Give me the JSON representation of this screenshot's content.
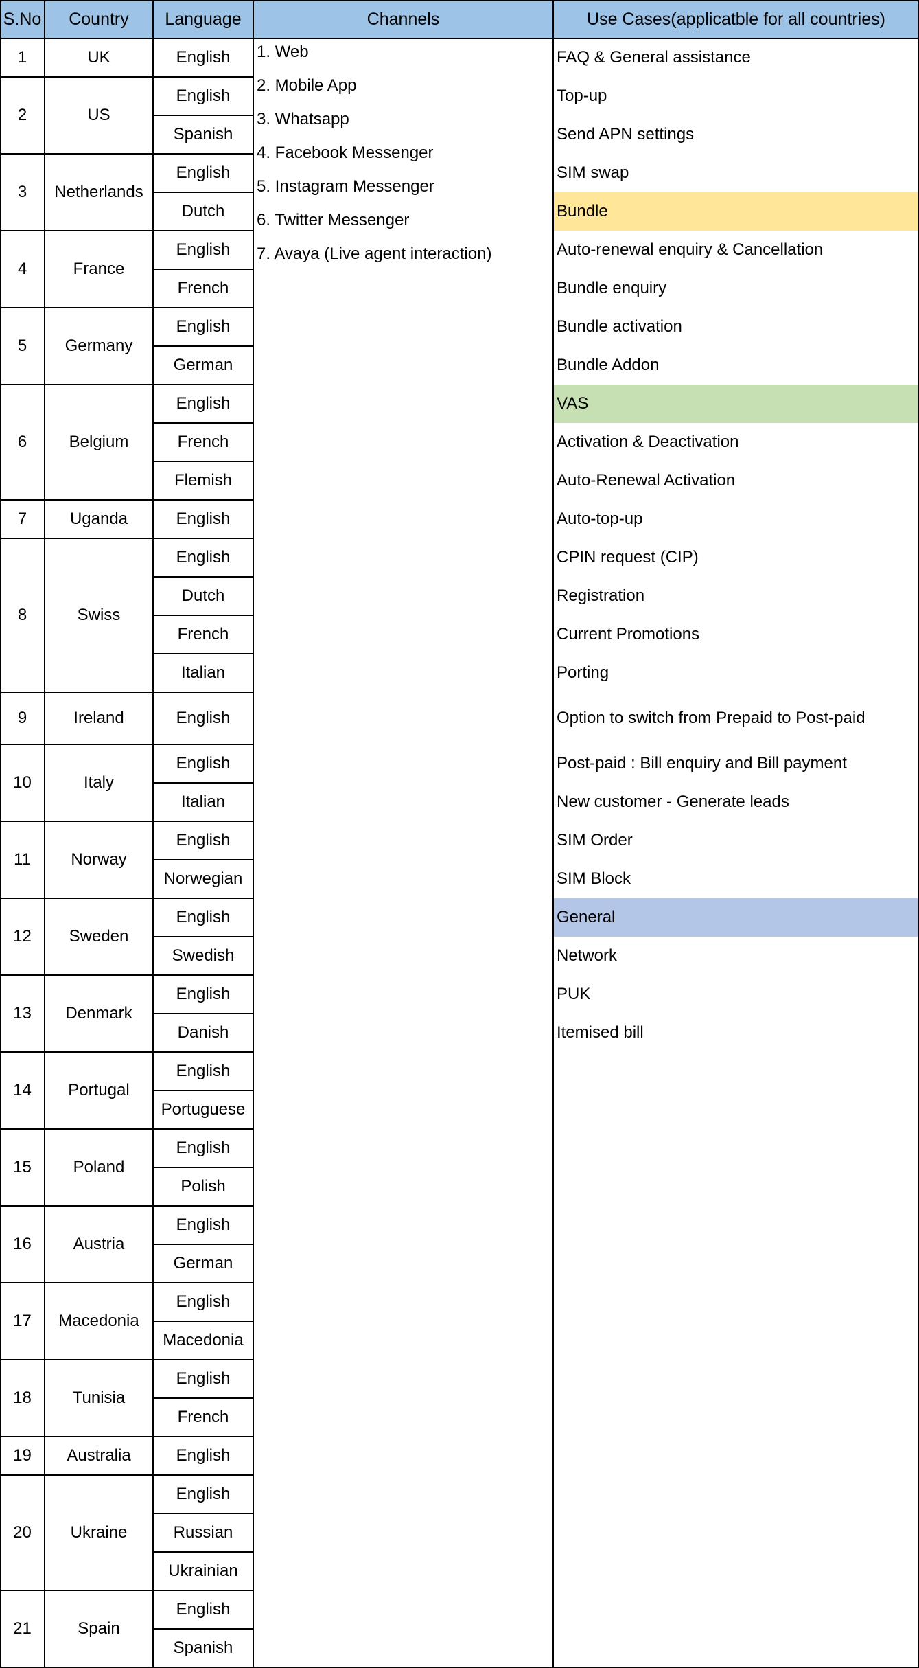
{
  "header": {
    "sno": "S.No",
    "country": "Country",
    "language": "Language",
    "channels": "Channels",
    "use_cases": "Use Cases(applicatble for all countries)"
  },
  "colors": {
    "header_bg": "#9DC3E6",
    "bundle_highlight": "#FFE699",
    "vas_highlight": "#C6E0B4",
    "general_highlight": "#B4C6E7",
    "grid_line": "#000000"
  },
  "countries": [
    {
      "sno": "1",
      "country": "UK",
      "languages": [
        "English"
      ]
    },
    {
      "sno": "2",
      "country": "US",
      "languages": [
        "English",
        "Spanish"
      ]
    },
    {
      "sno": "3",
      "country": "Netherlands",
      "languages": [
        "English",
        "Dutch"
      ]
    },
    {
      "sno": "4",
      "country": "France",
      "languages": [
        "English",
        "French"
      ]
    },
    {
      "sno": "5",
      "country": "Germany",
      "languages": [
        "English",
        "German"
      ]
    },
    {
      "sno": "6",
      "country": "Belgium",
      "languages": [
        "English",
        "French",
        "Flemish"
      ]
    },
    {
      "sno": "7",
      "country": "Uganda",
      "languages": [
        "English"
      ]
    },
    {
      "sno": "8",
      "country": "Swiss",
      "languages": [
        "English",
        "Dutch",
        "French",
        "Italian"
      ]
    },
    {
      "sno": "9",
      "country": "Ireland",
      "languages": [
        "English"
      ],
      "tall": true
    },
    {
      "sno": "10",
      "country": "Italy",
      "languages": [
        "English",
        "Italian"
      ]
    },
    {
      "sno": "11",
      "country": "Norway",
      "languages": [
        "English",
        "Norwegian"
      ]
    },
    {
      "sno": "12",
      "country": "Sweden",
      "languages": [
        "English",
        "Swedish"
      ]
    },
    {
      "sno": "13",
      "country": "Denmark",
      "languages": [
        "English",
        "Danish"
      ]
    },
    {
      "sno": "14",
      "country": "Portugal",
      "languages": [
        "English",
        "Portuguese"
      ]
    },
    {
      "sno": "15",
      "country": "Poland",
      "languages": [
        "English",
        "Polish"
      ]
    },
    {
      "sno": "16",
      "country": "Austria",
      "languages": [
        "English",
        "German"
      ]
    },
    {
      "sno": "17",
      "country": "Macedonia",
      "languages": [
        "English",
        "Macedonia"
      ]
    },
    {
      "sno": "18",
      "country": "Tunisia",
      "languages": [
        "English",
        "French"
      ]
    },
    {
      "sno": "19",
      "country": "Australia",
      "languages": [
        "English"
      ]
    },
    {
      "sno": "20",
      "country": "Ukraine",
      "languages": [
        "English",
        "Russian",
        "Ukrainian"
      ]
    },
    {
      "sno": "21",
      "country": "Spain",
      "languages": [
        "English",
        "Spanish"
      ]
    }
  ],
  "channels": [
    "1. Web",
    "2. Mobile App",
    "3. Whatsapp",
    "4. Facebook Messenger",
    "5. Instagram Messenger",
    "6. Twitter Messenger",
    "7. Avaya (Live agent interaction)"
  ],
  "use_cases": [
    {
      "label": "FAQ & General assistance"
    },
    {
      "label": "Top-up"
    },
    {
      "label": "Send APN settings"
    },
    {
      "label": "SIM swap"
    },
    {
      "label": "Bundle",
      "highlight": "bundle_highlight"
    },
    {
      "label": "Auto-renewal enquiry & Cancellation"
    },
    {
      "label": "Bundle enquiry"
    },
    {
      "label": "Bundle activation"
    },
    {
      "label": "Bundle Addon"
    },
    {
      "label": "VAS",
      "highlight": "vas_highlight"
    },
    {
      "label": "Activation & Deactivation"
    },
    {
      "label": "Auto-Renewal Activation"
    },
    {
      "label": "Auto-top-up"
    },
    {
      "label": "CPIN request (CIP)"
    },
    {
      "label": "Registration"
    },
    {
      "label": "Current Promotions"
    },
    {
      "label": "Porting"
    },
    {
      "label": "Option to switch from Prepaid to Post-paid"
    },
    {
      "label": "Post-paid : Bill enquiry and Bill payment"
    },
    {
      "label": "New customer - Generate leads"
    },
    {
      "label": "SIM Order"
    },
    {
      "label": "SIM Block"
    },
    {
      "label": "General",
      "highlight": "general_highlight"
    },
    {
      "label": "Network"
    },
    {
      "label": "PUK"
    },
    {
      "label": "Itemised bill"
    }
  ]
}
